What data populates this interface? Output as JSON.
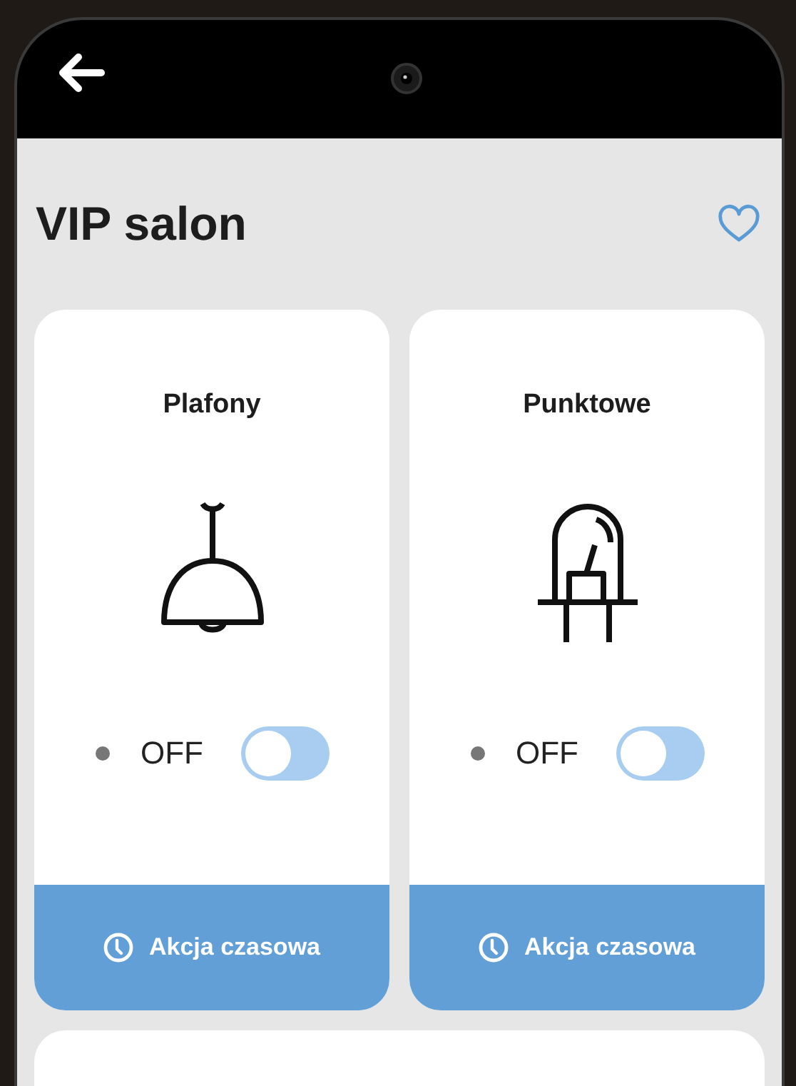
{
  "header": {
    "title": "VIP salon",
    "favorite": false
  },
  "devices": [
    {
      "kind": "ceiling-lamp",
      "name": "Plafony",
      "on": false,
      "state_label": "OFF",
      "action_label": "Akcja czasowa"
    },
    {
      "kind": "led",
      "name": "Punktowe",
      "on": false,
      "state_label": "OFF",
      "action_label": "Akcja czasowa"
    }
  ]
}
